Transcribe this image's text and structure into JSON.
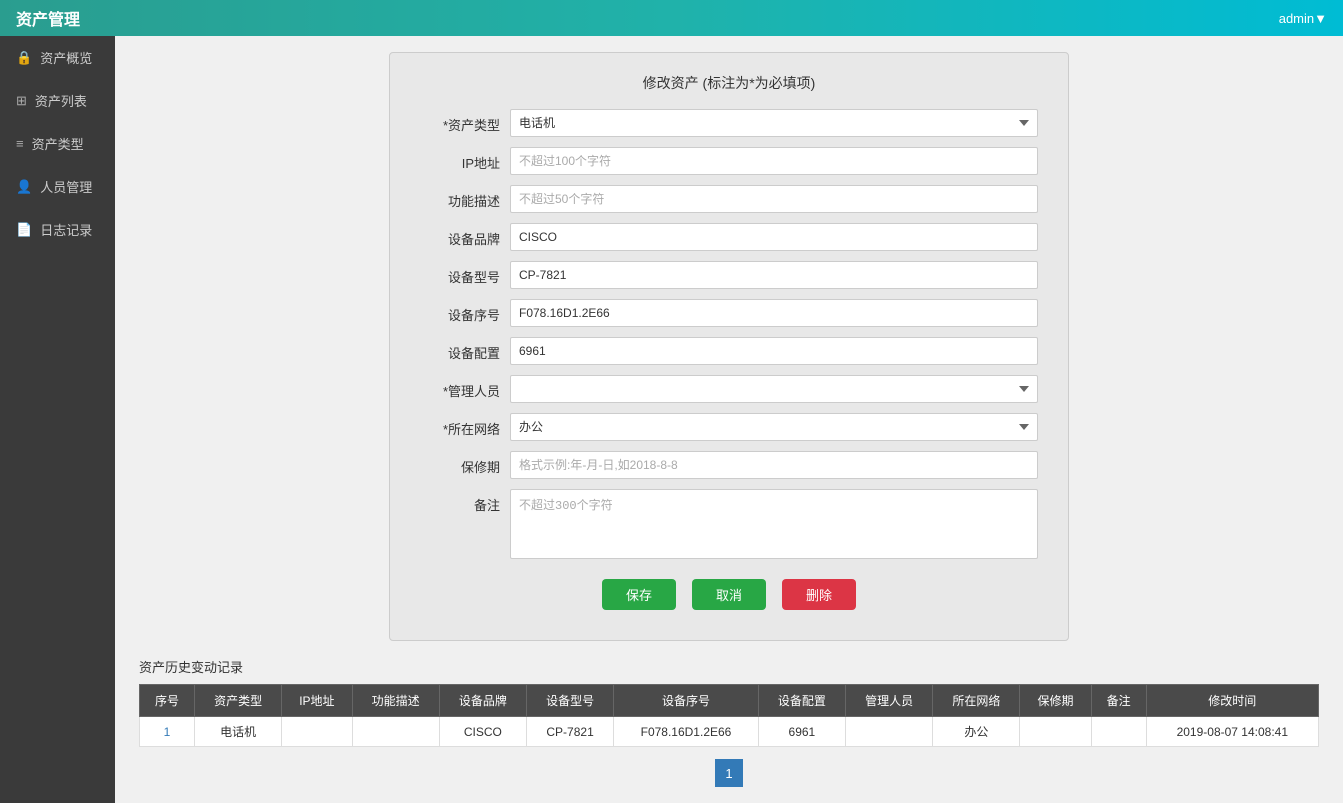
{
  "header": {
    "title": "资产管理",
    "user": "admin▼"
  },
  "sidebar": {
    "items": [
      {
        "id": "overview",
        "label": "资产概览",
        "icon": "🔒"
      },
      {
        "id": "list",
        "label": "资产列表",
        "icon": "⊞"
      },
      {
        "id": "type",
        "label": "资产类型",
        "icon": "≡"
      },
      {
        "id": "people",
        "label": "人员管理",
        "icon": "👤"
      },
      {
        "id": "log",
        "label": "日志记录",
        "icon": "📄"
      }
    ]
  },
  "form": {
    "title": "修改资产 (标注为*为必填项)",
    "fields": {
      "asset_type_label": "*资产类型",
      "asset_type_value": "电话机",
      "ip_label": "IP地址",
      "ip_placeholder": "不超过100个字符",
      "func_label": "功能描述",
      "func_placeholder": "不超过50个字符",
      "brand_label": "设备品牌",
      "brand_value": "CISCO",
      "model_label": "设备型号",
      "model_value": "CP-7821",
      "serial_label": "设备序号",
      "serial_value": "F078.16D1.2E66",
      "config_label": "设备配置",
      "config_value": "6961",
      "manager_label": "*管理人员",
      "manager_value": "",
      "network_label": "*所在网络",
      "network_value": "办公",
      "warranty_label": "保修期",
      "warranty_placeholder": "格式示例:年-月-日,如2018-8-8",
      "notes_label": "备注",
      "notes_placeholder": "不超过300个字符"
    },
    "buttons": {
      "save": "保存",
      "cancel": "取消",
      "delete": "删除"
    }
  },
  "history": {
    "title": "资产历史变动记录",
    "columns": [
      "序号",
      "资产类型",
      "IP地址",
      "功能描述",
      "设备品牌",
      "设备型号",
      "设备序号",
      "设备配置",
      "管理人员",
      "所在网络",
      "保修期",
      "备注",
      "修改时间"
    ],
    "rows": [
      {
        "id": "1",
        "asset_type": "电话机",
        "ip": "",
        "func": "",
        "brand": "CISCO",
        "model": "CP-7821",
        "serial": "F078.16D1.2E66",
        "config": "6961",
        "manager": "",
        "network": "办公",
        "warranty": "",
        "notes": "",
        "modify_time": "2019-08-07 14:08:41"
      }
    ]
  },
  "pagination": {
    "current": "1"
  }
}
